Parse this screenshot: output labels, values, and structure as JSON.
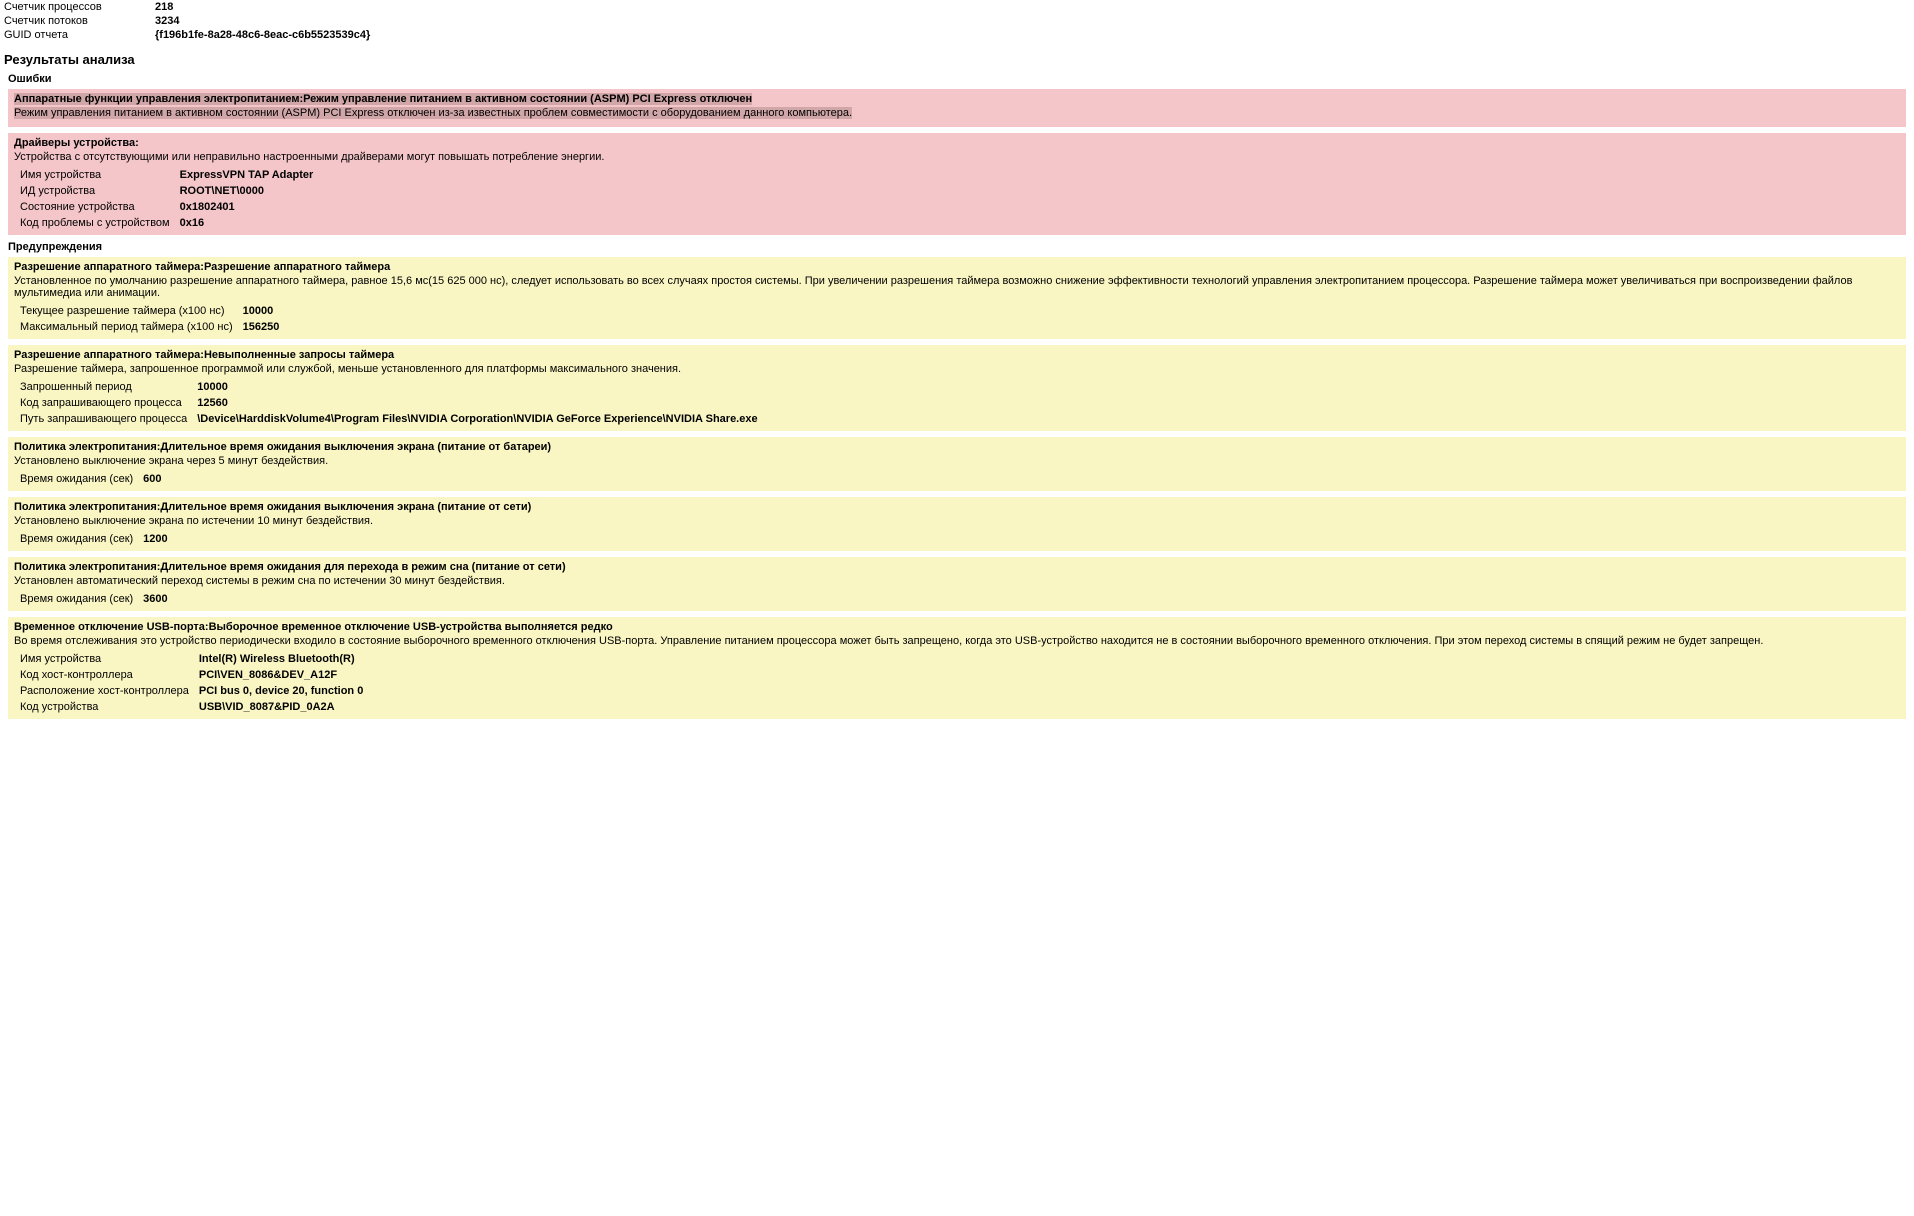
{
  "meta": {
    "proc_label": "Счетчик процессов",
    "proc_value": "218",
    "thread_label": "Счетчик потоков",
    "thread_value": "3234",
    "guid_label": "GUID отчета",
    "guid_value": "{f196b1fe-8a28-48c6-8eac-c6b5523539c4}"
  },
  "results_title": "Результаты анализа",
  "errors_title": "Ошибки",
  "warnings_title": "Предупреждения",
  "errors": {
    "aspm": {
      "header": "Аппаратные функции управления электропитанием:Режим управление питанием в активном состоянии (ASPM) PCI Express отключен",
      "desc": "Режим управления питанием в активном состоянии (ASPM) PCI Express отключен из-за известных проблем совместимости с оборудованием данного компьютера."
    },
    "drivers": {
      "header": "Драйверы устройства:",
      "desc": "Устройства с отсутствующими или неправильно настроенными драйверами могут повышать потребление энергии.",
      "rows": [
        {
          "k": "Имя устройства",
          "v": "ExpressVPN TAP Adapter"
        },
        {
          "k": "ИД устройства",
          "v": "ROOT\\NET\\0000"
        },
        {
          "k": "Состояние устройства",
          "v": "0x1802401"
        },
        {
          "k": "Код проблемы с устройством",
          "v": "0x16"
        }
      ]
    }
  },
  "warnings": {
    "timer1": {
      "header": "Разрешение аппаратного таймера:Разрешение аппаратного таймера",
      "desc": "Установленное по умолчанию разрешение аппаратного таймера, равное 15,6 мс(15 625 000 нс), следует использовать во всех случаях простоя системы. При увеличении разрешения таймера возможно снижение эффективности технологий управления электропитанием процессора. Разрешение таймера может увеличиваться при воспроизведении файлов мультимедиа или анимации.",
      "rows": [
        {
          "k": "Текущее разрешение таймера (x100 нс)",
          "v": "10000"
        },
        {
          "k": "Максимальный период таймера (x100 нс)",
          "v": "156250"
        }
      ]
    },
    "timer2": {
      "header": "Разрешение аппаратного таймера:Невыполненные запросы таймера",
      "desc": "Разрешение таймера, запрошенное программой или службой, меньше установленного для платформы максимального значения.",
      "rows": [
        {
          "k": "Запрошенный период",
          "v": "10000"
        },
        {
          "k": "Код запрашивающего процесса",
          "v": "12560"
        },
        {
          "k": "Путь запрашивающего процесса",
          "v": "\\Device\\HarddiskVolume4\\Program Files\\NVIDIA Corporation\\NVIDIA GeForce Experience\\NVIDIA Share.exe"
        }
      ]
    },
    "policy1": {
      "header": "Политика электропитания:Длительное время ожидания выключения экрана (питание от батареи)",
      "desc": "Установлено выключение экрана через 5 минут бездействия.",
      "rows": [
        {
          "k": "Время ожидания (сек)",
          "v": "600"
        }
      ]
    },
    "policy2": {
      "header": "Политика электропитания:Длительное время ожидания выключения экрана (питание от сети)",
      "desc": "Установлено выключение экрана по истечении 10 минут бездействия.",
      "rows": [
        {
          "k": "Время ожидания (сек)",
          "v": "1200"
        }
      ]
    },
    "policy3": {
      "header": "Политика электропитания:Длительное время ожидания для перехода в режим сна (питание от сети)",
      "desc": "Установлен автоматический переход системы в режим сна по истечении 30 минут бездействия.",
      "rows": [
        {
          "k": "Время ожидания (сек)",
          "v": "3600"
        }
      ]
    },
    "usb": {
      "header": "Временное отключение USB-порта:Выборочное временное отключение USB-устройства выполняется редко",
      "desc": "Во время отслеживания это устройство периодически входило в состояние выборочного временного отключения USB-порта. Управление питанием процессора может быть запрещено, когда это USB-устройство находится не в состоянии выборочного временного отключения. При этом переход системы в спящий режим не будет запрещен.",
      "rows": [
        {
          "k": "Имя устройства",
          "v": "Intel(R) Wireless Bluetooth(R)"
        },
        {
          "k": "Код хост-контроллера",
          "v": "PCI\\VEN_8086&DEV_A12F"
        },
        {
          "k": "Расположение хост-контроллера",
          "v": "PCI bus 0, device 20, function 0"
        },
        {
          "k": "Код устройства",
          "v": "USB\\VID_8087&PID_0A2A"
        }
      ]
    }
  }
}
